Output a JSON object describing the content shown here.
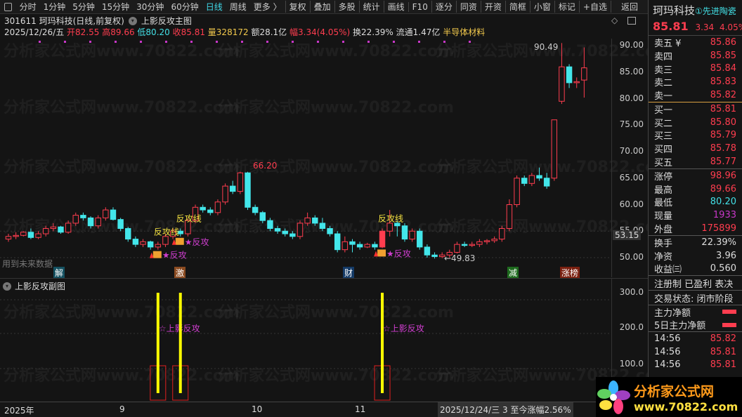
{
  "toolbar": {
    "items": [
      "分时",
      "1分钟",
      "5分钟",
      "15分钟",
      "30分钟",
      "60分钟",
      "日线",
      "周线",
      "更多 〉"
    ],
    "active": "日线",
    "actions": [
      "复权",
      "叠加",
      "多股",
      "统计",
      "画线",
      "F10",
      "逐分",
      "同资",
      "开资",
      "简框",
      "小窗",
      "标记",
      "+自选",
      "返回"
    ]
  },
  "header": {
    "code_name": "301611 珂玛科技(日线,前复权)",
    "indicator": "上影反攻主图",
    "date": "2025/12/26/五",
    "open": "开82.55",
    "high": "高89.66",
    "low": "低80.20",
    "close": "收85.81",
    "vol": "量328172",
    "amount": "额28.1亿",
    "change": "幅3.34(4.05%)",
    "turnover": "换22.39%",
    "float": "流通1.47亿",
    "sector": "半导体材料"
  },
  "main": {
    "y_ticks": [
      "90.00",
      "85.00",
      "80.00",
      "75.00",
      "70.00",
      "65.00",
      "60.00",
      "55.00",
      "50.00"
    ],
    "current_marker": "53.15",
    "annotations": {
      "peak": "66.20",
      "high_label": "90.49",
      "low_label": "←49.83",
      "future": "用到未来数据",
      "line_label": "反攻线",
      "signal": "反攻"
    },
    "tags": [
      "解",
      "激",
      "财",
      "减",
      "涨榜"
    ]
  },
  "sub": {
    "title": "上影反攻副图",
    "y_ticks": [
      "300.0",
      "200.0",
      "100.0"
    ],
    "signal_label": "☆上影反攻"
  },
  "xaxis": {
    "labels": [
      "2025年",
      "9",
      "10",
      "11"
    ],
    "status": "2025/12/24/三 3 至今涨幅2.56%"
  },
  "watermark": "分析家公式网www.70822.com",
  "logo": {
    "text": "分析家公式网",
    "url": "www.70822.com"
  },
  "quote": {
    "name": "珂玛科技",
    "sector": "①先进陶瓷",
    "price": "85.81",
    "change": "3.34",
    "pct": "4.05%",
    "asks": [
      {
        "l": "卖五 ¥",
        "v": "85.86"
      },
      {
        "l": "卖四",
        "v": "85.85"
      },
      {
        "l": "卖三",
        "v": "85.84"
      },
      {
        "l": "卖二",
        "v": "85.83"
      },
      {
        "l": "卖一",
        "v": "85.82"
      }
    ],
    "bids": [
      {
        "l": "买一",
        "v": "85.81"
      },
      {
        "l": "买二",
        "v": "85.80"
      },
      {
        "l": "买三",
        "v": "85.79"
      },
      {
        "l": "买四",
        "v": "85.78"
      },
      {
        "l": "买五",
        "v": "85.77"
      }
    ],
    "stats": [
      {
        "l": "涨停",
        "v": "98.96"
      },
      {
        "l": "最高",
        "v": "89.66"
      },
      {
        "l": "最低",
        "v": "80.20"
      },
      {
        "l": "现量",
        "v": "1933"
      },
      {
        "l": "外盘",
        "v": "175899"
      }
    ],
    "stats2": [
      {
        "l": "换手",
        "v": "22.39%"
      },
      {
        "l": "净资",
        "v": "3.96"
      },
      {
        "l": "收益㈢",
        "v": "0.560"
      }
    ],
    "flags": "注册制 已盈利 表决",
    "trade_status": "交易状态: 闭市阶段",
    "flow1": "主力净额",
    "flow2": "5日主力净额",
    "ticks": [
      {
        "t": "14:56",
        "v": "85.82"
      },
      {
        "t": "14:56",
        "v": "85.81"
      },
      {
        "t": "14:56",
        "v": "85.81"
      }
    ]
  },
  "chart_data": {
    "type": "candlestick",
    "price_range": [
      48,
      92
    ],
    "signal_indices": [
      20,
      23,
      50
    ],
    "signal_value": 300,
    "candles": [
      [
        53.5,
        54.5,
        53,
        54
      ],
      [
        54,
        54.8,
        53.5,
        54.2
      ],
      [
        54.2,
        55,
        54,
        54.8
      ],
      [
        54.8,
        55.5,
        53.5,
        53.8
      ],
      [
        53.8,
        55,
        53.5,
        54.5
      ],
      [
        54.5,
        56,
        54,
        55.5
      ],
      [
        55.5,
        56.5,
        55,
        55.8
      ],
      [
        55.8,
        56,
        54.5,
        54.8
      ],
      [
        54.8,
        57,
        54.5,
        56.5
      ],
      [
        56.5,
        58.5,
        56,
        58
      ],
      [
        58,
        58.5,
        57,
        57.5
      ],
      [
        57.5,
        57.8,
        55.5,
        56
      ],
      [
        56,
        58,
        55.5,
        57.5
      ],
      [
        57.5,
        59.5,
        57,
        59
      ],
      [
        59,
        59.5,
        57,
        57.2
      ],
      [
        57.2,
        57.5,
        55,
        55.5
      ],
      [
        55.5,
        55.8,
        53,
        53.5
      ],
      [
        53.5,
        54,
        52,
        52.5
      ],
      [
        52.5,
        53.5,
        52,
        53
      ],
      [
        53,
        53.2,
        51.5,
        52
      ],
      [
        52,
        53,
        51.5,
        52.5
      ],
      [
        52.5,
        54.5,
        52,
        54
      ],
      [
        54,
        55.5,
        53.5,
        55
      ],
      [
        55,
        55.5,
        54,
        54.5
      ],
      [
        54.5,
        57.5,
        54,
        57
      ],
      [
        57,
        60,
        56.5,
        59.5
      ],
      [
        59.5,
        60,
        58.5,
        59
      ],
      [
        59,
        59.5,
        58,
        58.5
      ],
      [
        58.5,
        61,
        58,
        60.5
      ],
      [
        60.5,
        64,
        60,
        63.5
      ],
      [
        63.5,
        64.5,
        62,
        62.5
      ],
      [
        62.5,
        66.2,
        62,
        66
      ],
      [
        66,
        66.2,
        59,
        59.5
      ],
      [
        59.5,
        60,
        58,
        58.5
      ],
      [
        58.5,
        58.8,
        56.5,
        57
      ],
      [
        57,
        57.5,
        55,
        55.5
      ],
      [
        55.5,
        56,
        54.5,
        55
      ],
      [
        55,
        55.5,
        54,
        54.5
      ],
      [
        54.5,
        55,
        53.5,
        54
      ],
      [
        54,
        57,
        53.5,
        56.5
      ],
      [
        56.5,
        58.5,
        56,
        57.5
      ],
      [
        57.5,
        58,
        56,
        56.5
      ],
      [
        56.5,
        57.5,
        55,
        55.5
      ],
      [
        55.5,
        56,
        54,
        54.5
      ],
      [
        54.5,
        55,
        51,
        51.5
      ],
      [
        51.5,
        54,
        51,
        53
      ],
      [
        53,
        53.5,
        51,
        52.5
      ],
      [
        52.5,
        53,
        51.5,
        52
      ],
      [
        52,
        52.8,
        51.8,
        52.5
      ],
      [
        52.5,
        53,
        51.5,
        52
      ],
      [
        52,
        55.5,
        51.8,
        55
      ],
      [
        55,
        59,
        54,
        56.5
      ],
      [
        56.5,
        57,
        54,
        56
      ],
      [
        56,
        56.5,
        53,
        53.5
      ],
      [
        53.5,
        55.5,
        53,
        55
      ],
      [
        55,
        55.5,
        51.5,
        52
      ],
      [
        52,
        52.5,
        50,
        50.5
      ],
      [
        50.5,
        51,
        49.83,
        50.2
      ],
      [
        50.2,
        51,
        49.9,
        50.5
      ],
      [
        50.5,
        51.5,
        50,
        51
      ],
      [
        51,
        53,
        50.8,
        52.5
      ],
      [
        52.5,
        53,
        52,
        52.3
      ],
      [
        52.3,
        53,
        52,
        52.5
      ],
      [
        52.5,
        53.5,
        52,
        53
      ],
      [
        53,
        53.5,
        52.5,
        53.2
      ],
      [
        53.2,
        54,
        52.8,
        53.5
      ],
      [
        53.5,
        56,
        53,
        55.5
      ],
      [
        55.5,
        61,
        55,
        60
      ],
      [
        60,
        65.5,
        59.5,
        65
      ],
      [
        65,
        65.5,
        63.5,
        64
      ],
      [
        64,
        66,
        63.5,
        65.5
      ],
      [
        65.5,
        67,
        64.5,
        65
      ],
      [
        65,
        66,
        63,
        63.5
      ],
      [
        65,
        76,
        64.5,
        76
      ],
      [
        79.5,
        90.49,
        79,
        86
      ],
      [
        86,
        86.5,
        82,
        83
      ],
      [
        83,
        84,
        82,
        83.2
      ],
      [
        83.5,
        89.66,
        80.2,
        85.81
      ]
    ]
  },
  "colors": {
    "up": "#ff3d4f",
    "down": "#43e6ea",
    "signal": "#ffff00",
    "bg": "#141414"
  }
}
